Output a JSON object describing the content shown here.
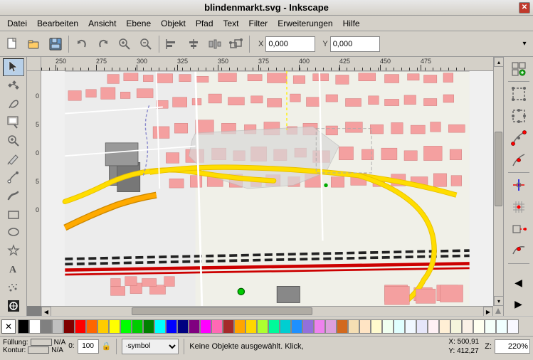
{
  "titleBar": {
    "title": "blindenmarkt.svg - Inkscape",
    "closeIcon": "✕"
  },
  "menuBar": {
    "items": [
      {
        "label": "Datei",
        "id": "datei"
      },
      {
        "label": "Bearbeiten",
        "id": "bearbeiten"
      },
      {
        "label": "Ansicht",
        "id": "ansicht"
      },
      {
        "label": "Ebene",
        "id": "ebene"
      },
      {
        "label": "Objekt",
        "id": "objekt"
      },
      {
        "label": "Pfad",
        "id": "pfad"
      },
      {
        "label": "Text",
        "id": "text"
      },
      {
        "label": "Filter",
        "id": "filter"
      },
      {
        "label": "Erweiterungen",
        "id": "erweiterungen"
      },
      {
        "label": "Hilfe",
        "id": "hilfe"
      }
    ]
  },
  "toolbar": {
    "coordX": {
      "label": "X",
      "value": "0,000"
    },
    "coordY": {
      "label": "Y",
      "value": "0,000"
    },
    "expandIcon": "▾"
  },
  "leftTools": [
    {
      "icon": "↖",
      "id": "select",
      "active": true
    },
    {
      "icon": "⊹",
      "id": "node"
    },
    {
      "icon": "~",
      "id": "tweak"
    },
    {
      "icon": "⬚",
      "id": "zoom-tool"
    },
    {
      "icon": "🔍",
      "id": "magnify"
    },
    {
      "icon": "✏",
      "id": "pencil"
    },
    {
      "icon": "✒",
      "id": "pen"
    },
    {
      "icon": "ꝏ",
      "id": "calligraphy"
    },
    {
      "icon": "□",
      "id": "rect"
    },
    {
      "icon": "○",
      "id": "ellipse"
    },
    {
      "icon": "★",
      "id": "star"
    },
    {
      "icon": "⬡",
      "id": "poly"
    },
    {
      "icon": "A",
      "id": "text-tool"
    },
    {
      "icon": "⊗",
      "id": "spray"
    },
    {
      "icon": "⬛",
      "id": "fill-tool"
    }
  ],
  "rightTools": [
    {
      "icon": "◈",
      "id": "snap-enable",
      "hasSnap": true
    },
    {
      "icon": "⊞",
      "id": "snap-bbox"
    },
    {
      "icon": "⊡",
      "id": "snap-bbox2"
    },
    {
      "icon": "⊠",
      "id": "snap-node"
    },
    {
      "icon": "◫",
      "id": "snap-node2"
    },
    {
      "icon": "⊟",
      "id": "snap-node3"
    },
    {
      "icon": "⊘",
      "id": "snap-guide"
    },
    {
      "icon": "⊕",
      "id": "snap-grid"
    },
    {
      "icon": "↔",
      "id": "snap-ext"
    },
    {
      "icon": "∿",
      "id": "snap-curve"
    },
    {
      "icon": "←",
      "id": "expand-left"
    },
    {
      "icon": "→",
      "id": "expand-right"
    }
  ],
  "rulers": {
    "topMarks": [
      "250",
      "275",
      "300",
      "325",
      "350",
      "375",
      "400",
      "425",
      "450",
      "475"
    ],
    "leftMarks": [
      "0",
      "5",
      "0",
      "5",
      "0"
    ]
  },
  "statusBar": {
    "fillLabel": "Füllung:",
    "fillValue": "N/A",
    "konturLabel": "Kontur:",
    "konturValue": "N/A",
    "opacity": "0:",
    "opacityValue": "100",
    "lockIcon": "🔒",
    "styleLabel": "·symbol",
    "styleValue": "·symbol",
    "statusMsg": "Keine Objekte ausgewählt. Klick,",
    "coordX": "X: 500,91",
    "coordY": "Y: 412,27",
    "zoomLabel": "Z:",
    "zoomValue": "220%"
  },
  "palette": {
    "xLabel": "✕",
    "colors": [
      "#000000",
      "#ffffff",
      "#808080",
      "#c0c0c0",
      "#800000",
      "#ff0000",
      "#ff6600",
      "#ffcc00",
      "#ffff00",
      "#00ff00",
      "#00cc00",
      "#008000",
      "#00ffff",
      "#0000ff",
      "#000080",
      "#800080",
      "#ff00ff",
      "#ff69b4",
      "#a52a2a",
      "#ffa500",
      "#ffd700",
      "#adff2f",
      "#00fa9a",
      "#00ced1",
      "#1e90ff",
      "#9370db",
      "#ee82ee",
      "#dda0dd",
      "#d2691e",
      "#f5deb3",
      "#ffe4c4",
      "#fffacd",
      "#f0fff0",
      "#e0ffff",
      "#f0f8ff",
      "#e6e6fa",
      "#fff0f5",
      "#ffefd5",
      "#f5f5dc",
      "#faf0e6",
      "#fffff0",
      "#f5fffa",
      "#f0ffff",
      "#f8f8ff"
    ]
  },
  "icons": {
    "chevron-right": "▶",
    "chevron-left": "◀",
    "chevron-down": "▾",
    "chevron-up": "▴",
    "snap-green": "◉"
  }
}
